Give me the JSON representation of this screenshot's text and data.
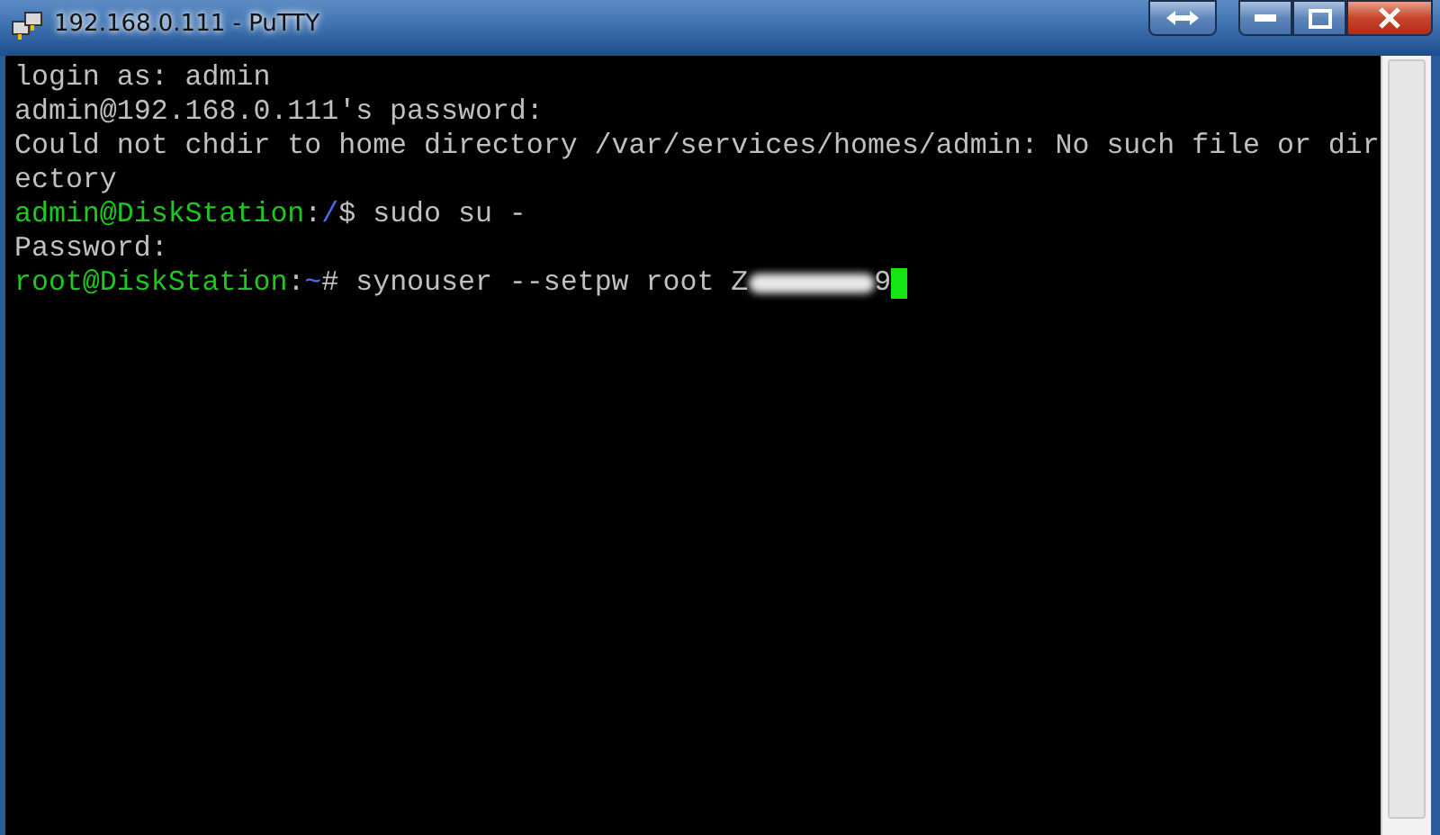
{
  "window": {
    "title": "192.168.0.111 - PuTTY"
  },
  "terminal": {
    "lines": [
      {
        "segments": [
          {
            "kind": "plain",
            "text": "login as: admin"
          }
        ]
      },
      {
        "segments": [
          {
            "kind": "plain",
            "text": "admin@192.168.0.111's password:"
          }
        ]
      },
      {
        "segments": [
          {
            "kind": "plain",
            "text": "Could not chdir to home directory /var/services/homes/admin: No such file or dir"
          }
        ]
      },
      {
        "segments": [
          {
            "kind": "plain",
            "text": "ectory"
          }
        ]
      },
      {
        "segments": [
          {
            "kind": "user",
            "text": "admin@DiskStation"
          },
          {
            "kind": "plain",
            "text": ":"
          },
          {
            "kind": "path",
            "text": "/"
          },
          {
            "kind": "plain",
            "text": "$ sudo su -"
          }
        ]
      },
      {
        "segments": [
          {
            "kind": "plain",
            "text": "Password:"
          }
        ]
      },
      {
        "segments": [
          {
            "kind": "user",
            "text": "root@DiskStation"
          },
          {
            "kind": "plain",
            "text": ":"
          },
          {
            "kind": "path",
            "text": "~"
          },
          {
            "kind": "plain",
            "text": "# synouser --setpw root Z"
          },
          {
            "kind": "redacted"
          },
          {
            "kind": "plain",
            "text": "9"
          },
          {
            "kind": "cursor"
          }
        ]
      }
    ]
  }
}
